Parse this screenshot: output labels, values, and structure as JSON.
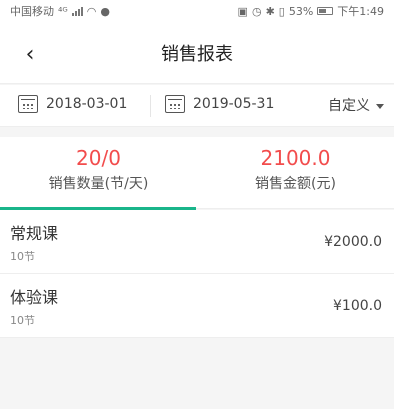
{
  "status_bar": {
    "carrier": "中国移动",
    "network": "⁴ᴳ",
    "battery": "53%",
    "time": "下午1:49"
  },
  "nav": {
    "back_icon": "‹",
    "title": "销售报表"
  },
  "date_filter": {
    "start_date": "2018-03-01",
    "end_date": "2019-05-31",
    "range_mode": "自定义"
  },
  "summary": {
    "quantity_value": "20/0",
    "quantity_label": "销售数量(节/天)",
    "amount_value": "2100.0",
    "amount_label": "销售金额(元)",
    "active_tab": "quantity"
  },
  "items": [
    {
      "title": "常规课",
      "sub": "10节",
      "amount": "¥2000.0"
    },
    {
      "title": "体验课",
      "sub": "10节",
      "amount": "¥100.0"
    }
  ],
  "colors": {
    "accent_red": "#f24c4c",
    "accent_green": "#19b58a"
  }
}
